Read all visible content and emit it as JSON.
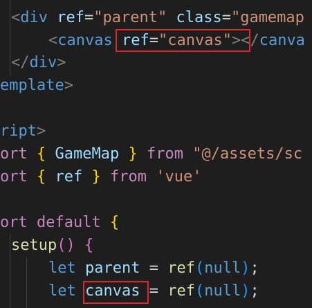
{
  "lines": [
    {
      "segments": []
    },
    {
      "segments": [
        {
          "cls": "t-tag-punct",
          "text": "<"
        },
        {
          "cls": "t-tag-name",
          "text": "div"
        },
        {
          "cls": "t-plain",
          "text": " "
        },
        {
          "cls": "t-attr",
          "text": "ref"
        },
        {
          "cls": "t-eq",
          "text": "="
        },
        {
          "cls": "t-str",
          "text": "\"parent\""
        },
        {
          "cls": "t-plain",
          "text": " "
        },
        {
          "cls": "t-attr",
          "text": "class"
        },
        {
          "cls": "t-eq",
          "text": "="
        },
        {
          "cls": "t-str",
          "text": "\"gamemap"
        }
      ]
    },
    {
      "segments": [
        {
          "cls": "t-tag-punct",
          "text": "<"
        },
        {
          "cls": "t-tag-name",
          "text": "canvas"
        },
        {
          "cls": "t-plain",
          "text": " "
        },
        {
          "cls": "t-attr",
          "text": "ref"
        },
        {
          "cls": "t-eq",
          "text": "="
        },
        {
          "cls": "t-str",
          "text": "\"canvas\""
        },
        {
          "cls": "t-tag-punct",
          "text": ">"
        },
        {
          "cls": "t-tag-punct",
          "text": "</"
        },
        {
          "cls": "t-tag-name",
          "text": "canva"
        }
      ]
    },
    {
      "segments": [
        {
          "cls": "t-tag-punct",
          "text": "</"
        },
        {
          "cls": "t-tag-name",
          "text": "div"
        },
        {
          "cls": "t-tag-punct",
          "text": ">"
        }
      ]
    },
    {
      "segments": [
        {
          "cls": "t-tag-name",
          "text": "emplate"
        },
        {
          "cls": "t-tag-punct",
          "text": ">"
        }
      ]
    },
    {
      "segments": []
    },
    {
      "segments": [
        {
          "cls": "t-tag-name",
          "text": "ript"
        },
        {
          "cls": "t-tag-punct",
          "text": ">"
        }
      ]
    },
    {
      "segments": [
        {
          "cls": "t-kw",
          "text": "ort"
        },
        {
          "cls": "t-plain",
          "text": " "
        },
        {
          "cls": "t-brace",
          "text": "{"
        },
        {
          "cls": "t-plain",
          "text": " "
        },
        {
          "cls": "t-var",
          "text": "GameMap"
        },
        {
          "cls": "t-plain",
          "text": " "
        },
        {
          "cls": "t-brace",
          "text": "}"
        },
        {
          "cls": "t-plain",
          "text": " "
        },
        {
          "cls": "t-kw",
          "text": "from"
        },
        {
          "cls": "t-plain",
          "text": " "
        },
        {
          "cls": "t-str",
          "text": "\"@/assets/sc"
        }
      ]
    },
    {
      "segments": [
        {
          "cls": "t-kw",
          "text": "ort"
        },
        {
          "cls": "t-plain",
          "text": " "
        },
        {
          "cls": "t-brace",
          "text": "{"
        },
        {
          "cls": "t-plain",
          "text": " "
        },
        {
          "cls": "t-var",
          "text": "ref"
        },
        {
          "cls": "t-plain",
          "text": " "
        },
        {
          "cls": "t-brace",
          "text": "}"
        },
        {
          "cls": "t-plain",
          "text": " "
        },
        {
          "cls": "t-kw",
          "text": "from"
        },
        {
          "cls": "t-plain",
          "text": " "
        },
        {
          "cls": "t-str",
          "text": "'vue'"
        }
      ]
    },
    {
      "segments": []
    },
    {
      "segments": [
        {
          "cls": "t-kw",
          "text": "ort"
        },
        {
          "cls": "t-plain",
          "text": " "
        },
        {
          "cls": "t-kw",
          "text": "default"
        },
        {
          "cls": "t-plain",
          "text": " "
        },
        {
          "cls": "t-brace",
          "text": "{"
        }
      ]
    },
    {
      "segments": [
        {
          "cls": "t-fn",
          "text": "setup"
        },
        {
          "cls": "t-brace2",
          "text": "()"
        },
        {
          "cls": "t-plain",
          "text": " "
        },
        {
          "cls": "t-brace2",
          "text": "{"
        }
      ]
    },
    {
      "segments": [
        {
          "cls": "t-keyword-blue",
          "text": "let"
        },
        {
          "cls": "t-plain",
          "text": " "
        },
        {
          "cls": "t-var",
          "text": "parent"
        },
        {
          "cls": "t-plain",
          "text": " = "
        },
        {
          "cls": "t-fn",
          "text": "ref"
        },
        {
          "cls": "t-brace3",
          "text": "("
        },
        {
          "cls": "t-keyword-blue",
          "text": "null"
        },
        {
          "cls": "t-brace3",
          "text": ")"
        },
        {
          "cls": "t-semi",
          "text": ";"
        }
      ]
    },
    {
      "segments": [
        {
          "cls": "t-keyword-blue",
          "text": "let"
        },
        {
          "cls": "t-plain",
          "text": " "
        },
        {
          "cls": "t-var",
          "text": "canvas"
        },
        {
          "cls": "t-plain",
          "text": " = "
        },
        {
          "cls": "t-fn",
          "text": "ref"
        },
        {
          "cls": "t-brace3",
          "text": "("
        },
        {
          "cls": "t-keyword-blue",
          "text": "null"
        },
        {
          "cls": "t-brace3",
          "text": ")"
        },
        {
          "cls": "t-semi",
          "text": ";"
        }
      ]
    }
  ],
  "highlight_color": "#e5232a"
}
